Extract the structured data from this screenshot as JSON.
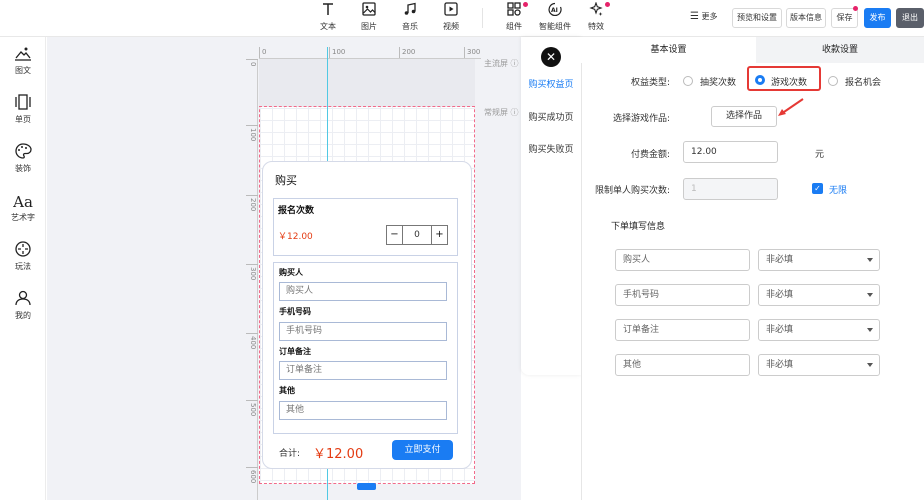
{
  "toolbar": {
    "tools": [
      {
        "label": "文本",
        "icon": "text-icon"
      },
      {
        "label": "图片",
        "icon": "image-icon"
      },
      {
        "label": "音乐",
        "icon": "music-icon"
      },
      {
        "label": "视频",
        "icon": "video-icon"
      },
      {
        "label": "组件",
        "icon": "component-icon"
      },
      {
        "label": "智能组件",
        "icon": "ai-component-icon"
      },
      {
        "label": "特效",
        "icon": "effects-icon"
      }
    ],
    "more": "更多",
    "preview": "预览和设置",
    "version": "版本信息",
    "save": "保存",
    "publish": "发布",
    "exit": "退出"
  },
  "leftbar": {
    "items": [
      {
        "label": "图文",
        "icon": "image-text-icon"
      },
      {
        "label": "单页",
        "icon": "single-page-icon"
      },
      {
        "label": "装饰",
        "icon": "palette-icon"
      },
      {
        "label": "艺术字",
        "icon": "art-text-icon"
      },
      {
        "label": "玩法",
        "icon": "gameplay-icon"
      },
      {
        "label": "我的",
        "icon": "user-icon"
      }
    ]
  },
  "canvas": {
    "ruler_top": [
      "0",
      "100",
      "200",
      "300"
    ],
    "ruler_left": [
      "0",
      "100",
      "200",
      "300",
      "400",
      "500",
      "600"
    ],
    "main_screen_label": "主流屏",
    "normal_screen_label": "常规屏"
  },
  "card": {
    "title": "购买",
    "entry_title": "报名次数",
    "price": "￥12.00",
    "minus": "−",
    "qty": "0",
    "plus": "+",
    "fields": [
      {
        "label": "购买人",
        "placeholder": "购买人"
      },
      {
        "label": "手机号码",
        "placeholder": "手机号码"
      },
      {
        "label": "订单备注",
        "placeholder": "订单备注"
      },
      {
        "label": "其他",
        "placeholder": "其他"
      }
    ],
    "total_label": "合计:",
    "total_value": "￥12.00",
    "pay_button": "立即支付"
  },
  "tabs": {
    "close": "✕",
    "items": [
      "购买权益页",
      "购买成功页",
      "购买失败页"
    ]
  },
  "panel": {
    "tab_basic": "基本设置",
    "tab_payment": "收款设置",
    "benefit_type_label": "权益类型:",
    "options": [
      "抽奖次数",
      "游戏次数",
      "报名机会"
    ],
    "select_game_label": "选择游戏作品:",
    "select_game_button": "选择作品",
    "amount_label": "付费金额:",
    "amount_value": "12.00",
    "amount_unit": "元",
    "limit_label": "限制单人购买次数:",
    "limit_value": "1",
    "unlimited_label": "无限",
    "order_info_title": "下单填写信息",
    "order_fields": [
      {
        "name": "购买人",
        "required": "非必填"
      },
      {
        "name": "手机号码",
        "required": "非必填"
      },
      {
        "name": "订单备注",
        "required": "非必填"
      },
      {
        "name": "其他",
        "required": "非必填"
      }
    ]
  },
  "colors": {
    "accent": "#1a7cf3",
    "price": "#e43b12",
    "highlight": "#e53935",
    "guide": "#51c9e4",
    "dashed": "#f26a8a"
  }
}
